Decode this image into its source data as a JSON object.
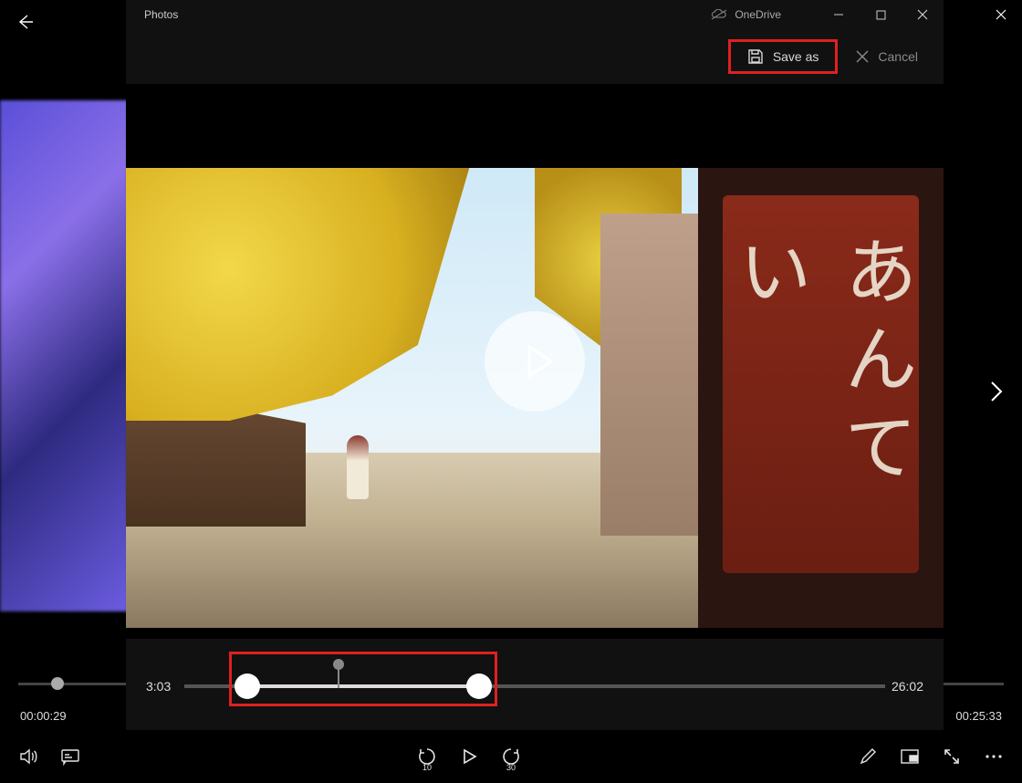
{
  "app": {
    "title": "Photos"
  },
  "cloud": {
    "label": "OneDrive"
  },
  "toolbar": {
    "save_as_label": "Save as",
    "cancel_label": "Cancel"
  },
  "trim": {
    "start_time": "3:03",
    "end_time": "26:02",
    "start_percent": 9,
    "playhead_percent": 22,
    "selection_end_percent": 42
  },
  "outer_player": {
    "current_time": "00:00:29",
    "total_time": "00:25:33",
    "seek_percent": 4,
    "skip_back_seconds": "10",
    "skip_fwd_seconds": "30"
  }
}
